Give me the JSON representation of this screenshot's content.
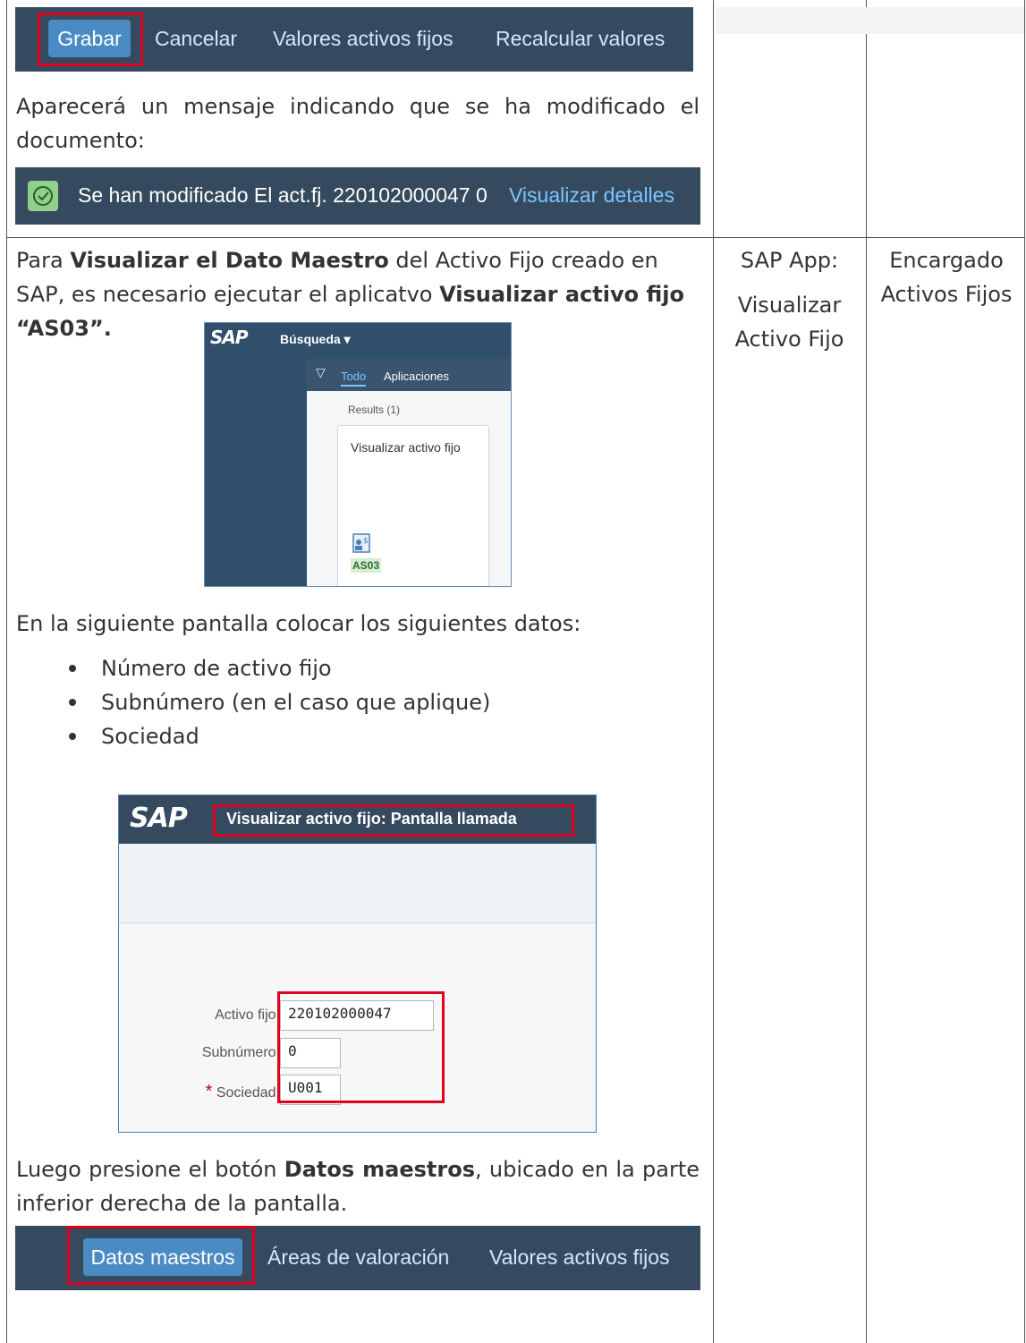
{
  "top_toolbar": {
    "save_label": "Grabar",
    "cancel_label": "Cancelar",
    "asset_values_label": "Valores activos fijos",
    "recalc_label": "Recalcular valores"
  },
  "intro_text": "Aparecerá un mensaje indicando que se ha modificado el documento:",
  "status_bar": {
    "message": "Se han modificado El act.fj. 220102000047 0",
    "details_link": "Visualizar detalles"
  },
  "step": {
    "intro_prefix": "Para ",
    "intro_bold1": "Visualizar el Dato Maestro",
    "intro_mid": " del Activo Fijo creado en SAP, es necesario ejecutar el  aplicatvo ",
    "intro_bold2": "Visualizar activo fijo “AS03”.",
    "search_panel": {
      "logo": "SAP",
      "search_label": "Búsqueda ▾",
      "filter_all": "Todo",
      "filter_apps": "Aplicaciones",
      "results": "Results (1)",
      "tile_title": "Visualizar activo fijo",
      "tile_code": "AS03"
    },
    "fields_intro": "En la siguiente pantalla colocar los siguientes datos:",
    "bullets": [
      "Número de activo fijo",
      "Subnúmero (en el caso que aplique)",
      "Sociedad"
    ],
    "initial_screen": {
      "logo": "SAP",
      "title": "Visualizar activo fijo: Pantalla llamada",
      "fields": [
        {
          "label": "Activo fijo:",
          "value": "220102000047"
        },
        {
          "label": "Subnúmero:",
          "value": "0"
        },
        {
          "label": "Sociedad:",
          "value": "U001",
          "required_mark": "*"
        }
      ]
    },
    "button_text_prefix": "Luego presione el botón ",
    "button_text_bold": "Datos maestros",
    "button_text_suffix": ", ubicado en la parte inferior derecha de la pantalla.",
    "bottom_toolbar": {
      "master_data_label": "Datos maestros",
      "valuation_areas_label": "Áreas de valoración",
      "asset_values_label": "Valores activos fijos"
    }
  },
  "roles": {
    "app_label": "SAP App:",
    "app_name": "Visualizar Activo Fijo",
    "responsible": "Encargado Activos Fijos"
  }
}
